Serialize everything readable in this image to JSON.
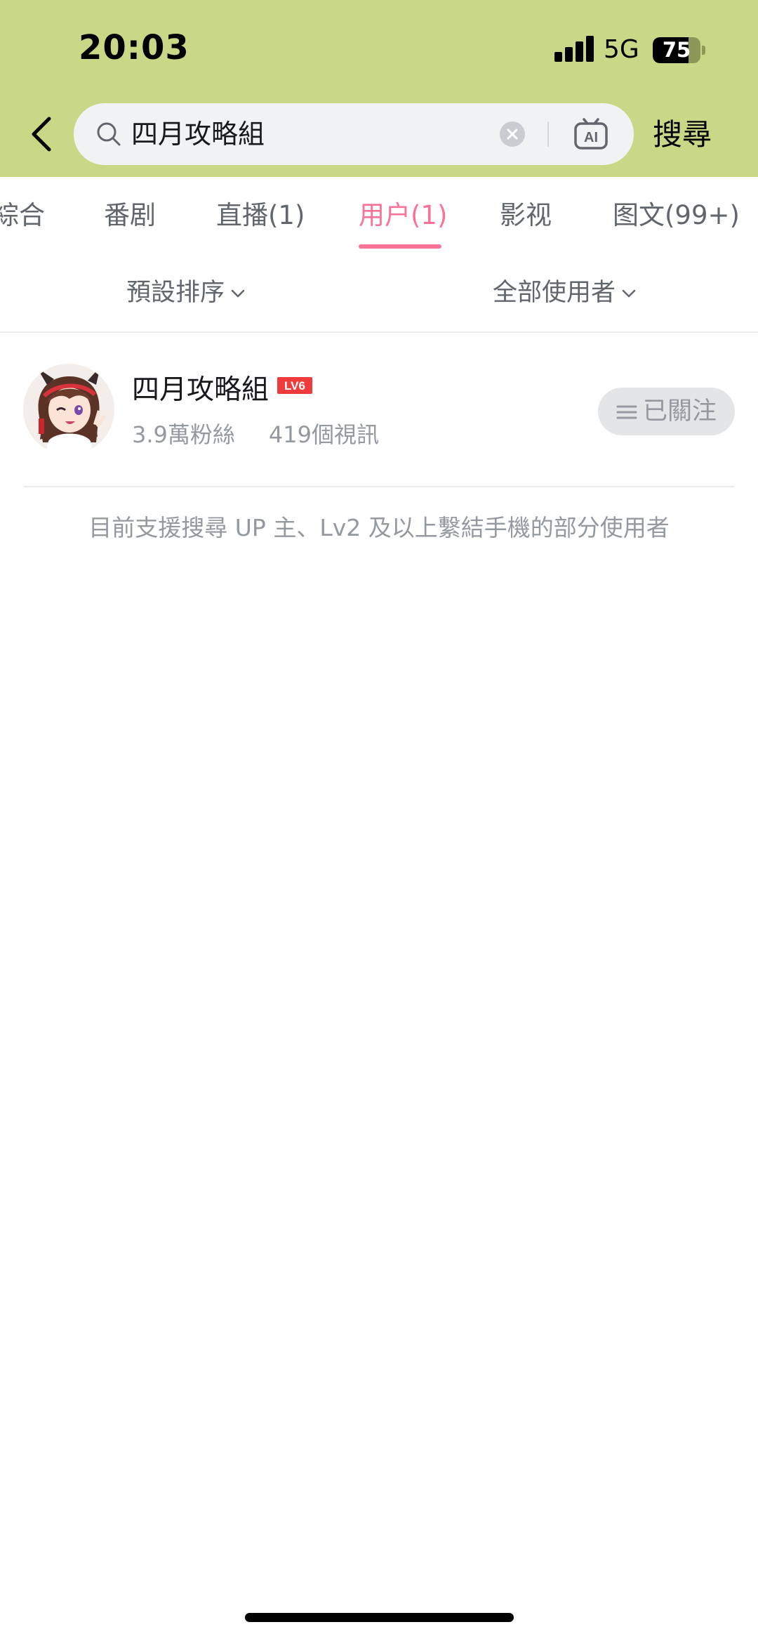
{
  "status_bar": {
    "time": "20:03",
    "network": "5G",
    "battery": "75",
    "battery_level": 0.75
  },
  "search": {
    "query": "四月攻略組",
    "submit_label": "搜尋",
    "icons": [
      "back-icon",
      "search-icon",
      "clear-icon",
      "ai-icon"
    ]
  },
  "tabs": [
    {
      "label": "綜合",
      "active": false
    },
    {
      "label": "番剧",
      "active": false
    },
    {
      "label": "直播(1)",
      "active": false
    },
    {
      "label": "用户(1)",
      "active": true
    },
    {
      "label": "影视",
      "active": false
    },
    {
      "label": "图文(99+)",
      "active": false
    }
  ],
  "filters": {
    "sort": "預設排序",
    "user_type": "全部使用者"
  },
  "results": {
    "user": {
      "name": "四月攻略組",
      "level": "LV6",
      "followers": "3.9萬粉絲",
      "videos": "419個視訊",
      "follow_label": "已關注"
    },
    "notice": "目前支援搜尋 UP 主、Lv2 及以上繫結手機的部分使用者"
  },
  "colors": {
    "header_bg": "#c9d887",
    "accent": "#fb7299",
    "level_badge": "#ef3b3b"
  }
}
